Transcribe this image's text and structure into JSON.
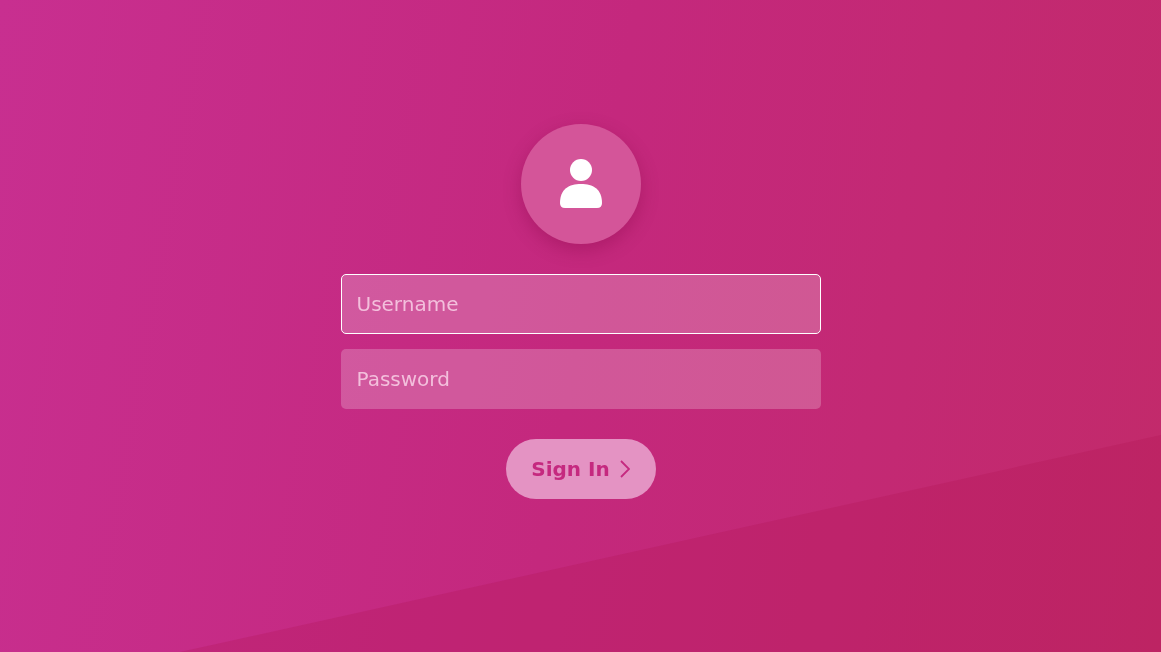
{
  "avatar": {
    "kind": "user"
  },
  "fields": [
    {
      "placeholder": "Username",
      "focused": true
    },
    {
      "placeholder": "Password",
      "focused": false
    }
  ],
  "submit": {
    "label": "Sign In"
  }
}
